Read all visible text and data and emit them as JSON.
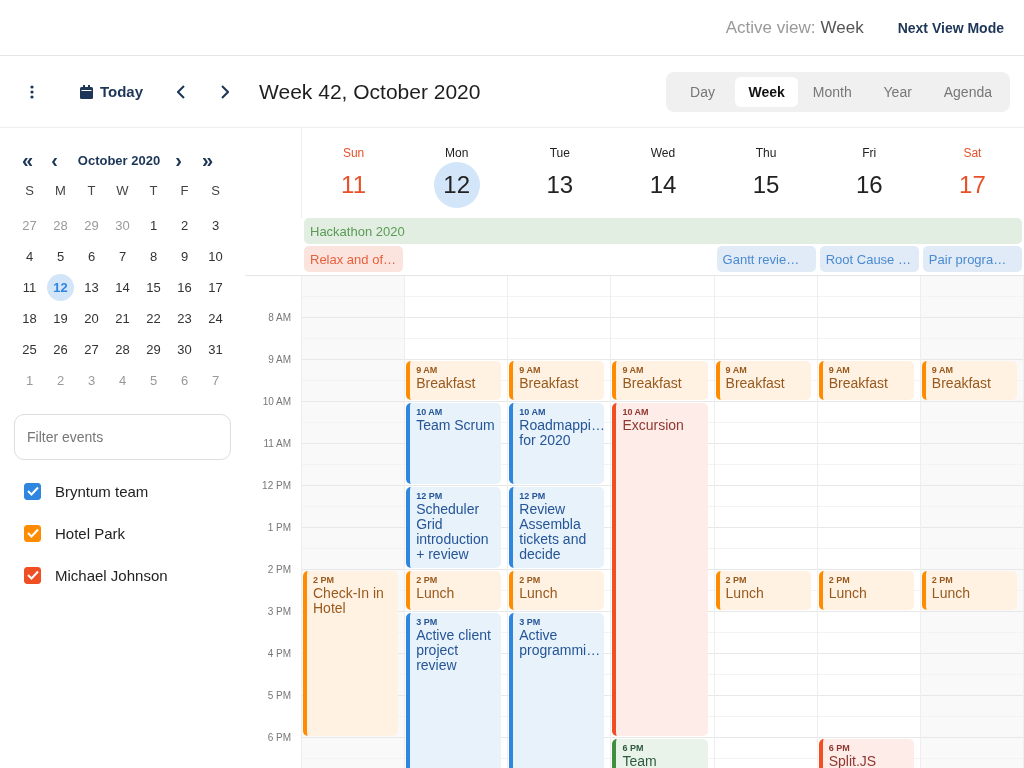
{
  "top_bar": {
    "active_view_label": "Active view:",
    "active_view_value": "Week",
    "next_view_button": "Next View Mode"
  },
  "toolbar": {
    "today_button": "Today",
    "title": "Week 42, October 2020",
    "view_modes": [
      {
        "label": "Day",
        "selected": false
      },
      {
        "label": "Week",
        "selected": true
      },
      {
        "label": "Month",
        "selected": false
      },
      {
        "label": "Year",
        "selected": false
      },
      {
        "label": "Agenda",
        "selected": false
      }
    ]
  },
  "sidebar": {
    "mini_calendar": {
      "title": "October 2020",
      "prev_year": "«",
      "prev_month": "‹",
      "next_month": "›",
      "next_year": "»",
      "weekdays": [
        "S",
        "M",
        "T",
        "W",
        "T",
        "F",
        "S"
      ],
      "weeks": [
        [
          {
            "day": "27",
            "other_month": true,
            "selected": false
          },
          {
            "day": "28",
            "other_month": true,
            "selected": false
          },
          {
            "day": "29",
            "other_month": true,
            "selected": false
          },
          {
            "day": "30",
            "other_month": true,
            "selected": false
          },
          {
            "day": "1",
            "other_month": false,
            "selected": false
          },
          {
            "day": "2",
            "other_month": false,
            "selected": false
          },
          {
            "day": "3",
            "other_month": false,
            "selected": false
          }
        ],
        [
          {
            "day": "4",
            "other_month": false,
            "selected": false
          },
          {
            "day": "5",
            "other_month": false,
            "selected": false
          },
          {
            "day": "6",
            "other_month": false,
            "selected": false
          },
          {
            "day": "7",
            "other_month": false,
            "selected": false
          },
          {
            "day": "8",
            "other_month": false,
            "selected": false
          },
          {
            "day": "9",
            "other_month": false,
            "selected": false
          },
          {
            "day": "10",
            "other_month": false,
            "selected": false
          }
        ],
        [
          {
            "day": "11",
            "other_month": false,
            "selected": false
          },
          {
            "day": "12",
            "other_month": false,
            "selected": true
          },
          {
            "day": "13",
            "other_month": false,
            "selected": false
          },
          {
            "day": "14",
            "other_month": false,
            "selected": false
          },
          {
            "day": "15",
            "other_month": false,
            "selected": false
          },
          {
            "day": "16",
            "other_month": false,
            "selected": false
          },
          {
            "day": "17",
            "other_month": false,
            "selected": false
          }
        ],
        [
          {
            "day": "18",
            "other_month": false,
            "selected": false
          },
          {
            "day": "19",
            "other_month": false,
            "selected": false
          },
          {
            "day": "20",
            "other_month": false,
            "selected": false
          },
          {
            "day": "21",
            "other_month": false,
            "selected": false
          },
          {
            "day": "22",
            "other_month": false,
            "selected": false
          },
          {
            "day": "23",
            "other_month": false,
            "selected": false
          },
          {
            "day": "24",
            "other_month": false,
            "selected": false
          }
        ],
        [
          {
            "day": "25",
            "other_month": false,
            "selected": false
          },
          {
            "day": "26",
            "other_month": false,
            "selected": false
          },
          {
            "day": "27",
            "other_month": false,
            "selected": false
          },
          {
            "day": "28",
            "other_month": false,
            "selected": false
          },
          {
            "day": "29",
            "other_month": false,
            "selected": false
          },
          {
            "day": "30",
            "other_month": false,
            "selected": false
          },
          {
            "day": "31",
            "other_month": false,
            "selected": false
          }
        ],
        [
          {
            "day": "1",
            "other_month": true,
            "selected": false
          },
          {
            "day": "2",
            "other_month": true,
            "selected": false
          },
          {
            "day": "3",
            "other_month": true,
            "selected": false
          },
          {
            "day": "4",
            "other_month": true,
            "selected": false
          },
          {
            "day": "5",
            "other_month": true,
            "selected": false
          },
          {
            "day": "6",
            "other_month": true,
            "selected": false
          },
          {
            "day": "7",
            "other_month": true,
            "selected": false
          }
        ]
      ]
    },
    "filter": {
      "placeholder": "Filter events"
    },
    "calendars": [
      {
        "name": "Bryntum team",
        "checked": true,
        "color": "#2e86de"
      },
      {
        "name": "Hotel Park",
        "checked": true,
        "color": "#ff8c00"
      },
      {
        "name": "Michael Johnson",
        "checked": true,
        "color": "#f04e23"
      }
    ]
  },
  "week": {
    "days": [
      {
        "name": "Sun",
        "number": "11",
        "weekend": true,
        "selected": false
      },
      {
        "name": "Mon",
        "number": "12",
        "weekend": false,
        "selected": true
      },
      {
        "name": "Tue",
        "number": "13",
        "weekend": false,
        "selected": false
      },
      {
        "name": "Wed",
        "number": "14",
        "weekend": false,
        "selected": false
      },
      {
        "name": "Thu",
        "number": "15",
        "weekend": false,
        "selected": false
      },
      {
        "name": "Fri",
        "number": "16",
        "weekend": false,
        "selected": false
      },
      {
        "name": "Sat",
        "number": "17",
        "weekend": true,
        "selected": false
      }
    ],
    "all_day_events": [
      {
        "title": "Hackathon 2020",
        "color": "#5a9a55"
      },
      {
        "title": "Relax and of…",
        "color": "#e8603c"
      },
      {
        "title": "Gantt revie…",
        "color": "#4a8ad0"
      },
      {
        "title": "Root Cause …",
        "color": "#4a8ad0"
      },
      {
        "title": "Pair progra…",
        "color": "#4a8ad0"
      }
    ],
    "hours": [
      "8 AM",
      "9 AM",
      "10 AM",
      "11 AM",
      "12 PM",
      "1 PM",
      "2 PM",
      "3 PM",
      "4 PM",
      "5 PM",
      "6 PM"
    ],
    "events": [
      {
        "time": "2 PM",
        "title": "Check-In in Hotel",
        "color": "#ff8c00"
      },
      {
        "time": "9 AM",
        "title": "Breakfast",
        "color": "#ff8c00"
      },
      {
        "time": "10 AM",
        "title": "Team Scrum",
        "color": "#2e86de"
      },
      {
        "time": "12 PM",
        "title": "Scheduler Grid introduction + review",
        "color": "#2e86de"
      },
      {
        "time": "2 PM",
        "title": "Lunch",
        "color": "#ff8c00"
      },
      {
        "time": "3 PM",
        "title": "Active client project review",
        "color": "#2e86de"
      },
      {
        "time": "9 AM",
        "title": "Breakfast",
        "color": "#ff8c00"
      },
      {
        "time": "10 AM",
        "title": "Roadmappi… for 2020",
        "color": "#2e86de"
      },
      {
        "time": "12 PM",
        "title": "Review Assembla tickets and decide",
        "color": "#2e86de"
      },
      {
        "time": "2 PM",
        "title": "Lunch",
        "color": "#ff8c00"
      },
      {
        "time": "3 PM",
        "title": "Active programmi…",
        "color": "#2e86de"
      },
      {
        "time": "9 AM",
        "title": "Breakfast",
        "color": "#ff8c00"
      },
      {
        "time": "10 AM",
        "title": "Excursion",
        "color": "#f04e23"
      },
      {
        "time": "6 PM",
        "title": "Team",
        "color": "#3f8f3f"
      },
      {
        "time": "9 AM",
        "title": "Breakfast",
        "color": "#ff8c00"
      },
      {
        "time": "2 PM",
        "title": "Lunch",
        "color": "#ff8c00"
      },
      {
        "time": "9 AM",
        "title": "Breakfast",
        "color": "#ff8c00"
      },
      {
        "time": "2 PM",
        "title": "Lunch",
        "color": "#ff8c00"
      },
      {
        "time": "6 PM",
        "title": "Split.JS",
        "color": "#f04e23"
      },
      {
        "time": "9 AM",
        "title": "Breakfast",
        "color": "#ff8c00"
      },
      {
        "time": "2 PM",
        "title": "Lunch",
        "color": "#ff8c00"
      }
    ]
  }
}
